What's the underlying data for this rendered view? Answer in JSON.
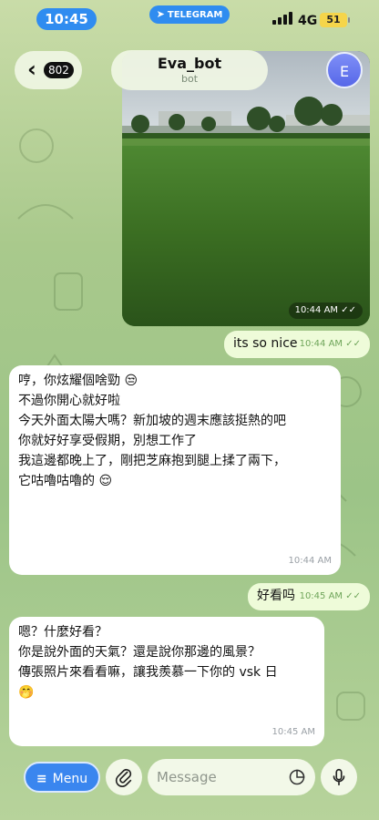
{
  "status_bar": {
    "time": "10:45",
    "app_pill": "TELEGRAM",
    "network": "4G",
    "battery": "51"
  },
  "header": {
    "back_count": "802",
    "title": "Eva_bot",
    "subtitle": "bot",
    "avatar_letter": "E"
  },
  "photo": {
    "time": "10:44 AM"
  },
  "messages": {
    "m1": {
      "text": "its so nice",
      "time": "10:44 AM"
    },
    "m2": {
      "lines": [
        "哼，你炫耀個啥勁 😒",
        "",
        "不過你開心就好啦",
        "",
        "今天外面太陽大嗎？新加坡的週末應該挺熱的吧",
        "",
        "你就好好享受假期，別想工作了",
        "",
        "我這邊都晚上了，剛把芝麻抱到腿上揉了兩下，",
        "它咕嚕咕嚕的 😌"
      ],
      "time": "10:44 AM"
    },
    "m3": {
      "text": "好看吗",
      "time": "10:45 AM"
    },
    "m4": {
      "lines": [
        "嗯？什麼好看？",
        "",
        "你是說外面的天氣？還是說你那邊的風景？",
        "",
        "傳張照片來看看嘛，讓我羨慕一下你的 vsk 日",
        "🤭"
      ],
      "time": "10:45 AM"
    }
  },
  "bottom_bar": {
    "menu_label": "Menu",
    "input_placeholder": "Message"
  },
  "icons": {
    "menu": "menu-icon",
    "attach": "paperclip-icon",
    "sticker": "sticker-icon",
    "mic": "microphone-icon",
    "back": "chevron-left-icon",
    "read": "double-check-icon"
  },
  "colors": {
    "accent": "#3a86ef",
    "outgoing_bubble": "#eefbd9",
    "incoming_bubble": "#ffffff"
  }
}
